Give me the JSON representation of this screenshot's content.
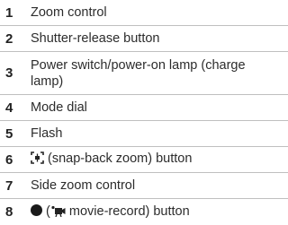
{
  "items": [
    {
      "num": "1",
      "label": "Zoom control"
    },
    {
      "num": "2",
      "label": "Shutter-release button"
    },
    {
      "num": "3",
      "label": "Power switch/power-on lamp (charge lamp)"
    },
    {
      "num": "4",
      "label": "Mode dial"
    },
    {
      "num": "5",
      "label": "Flash"
    },
    {
      "num": "6",
      "label": "(snap-back zoom) button",
      "icon": "snap-back-zoom-icon"
    },
    {
      "num": "7",
      "label": "Side zoom control"
    },
    {
      "num": "8",
      "prefix": "(",
      "label": "movie-record) button",
      "icons": [
        "filled-circle-icon",
        "movie-record-icon"
      ]
    }
  ]
}
